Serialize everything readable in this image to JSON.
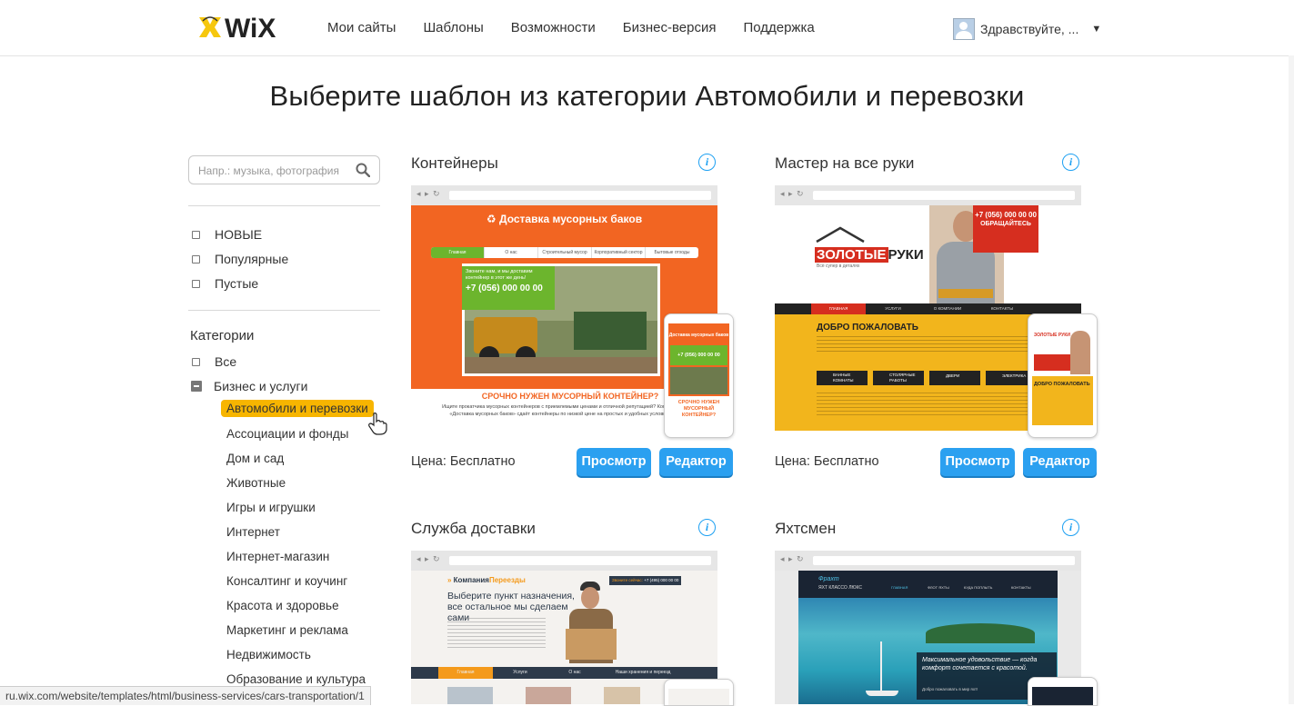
{
  "header": {
    "nav": [
      {
        "label": "Мои сайты"
      },
      {
        "label": "Шаблоны"
      },
      {
        "label": "Возможности"
      },
      {
        "label": "Бизнес-версия"
      },
      {
        "label": "Поддержка"
      }
    ],
    "user_greeting": "Здравствуйте, ...",
    "logo_text": "WiX"
  },
  "page_title": "Выберите шаблон из категории Автомобили и перевозки",
  "sidebar": {
    "search_placeholder": "Напр.: музыка, фотография",
    "filters": [
      {
        "label": "НОВЫЕ"
      },
      {
        "label": "Популярные"
      },
      {
        "label": "Пустые"
      }
    ],
    "categories_title": "Категории",
    "top_categories": [
      {
        "label": "Все"
      },
      {
        "label": "Бизнес и услуги"
      }
    ],
    "subcategories": [
      {
        "label": "Автомобили и перевозки",
        "active": true
      },
      {
        "label": "Ассоциации и фонды"
      },
      {
        "label": "Дом и сад"
      },
      {
        "label": "Животные"
      },
      {
        "label": "Игры и игрушки"
      },
      {
        "label": "Интернет"
      },
      {
        "label": "Интернет-магазин"
      },
      {
        "label": "Консалтинг и коучинг"
      },
      {
        "label": "Красота и здоровье"
      },
      {
        "label": "Маркетинг и реклама"
      },
      {
        "label": "Недвижимость"
      },
      {
        "label": "Образование и культура"
      }
    ]
  },
  "templates": [
    {
      "title": "Контейнеры",
      "price": "Цена: Бесплатно",
      "preview_label": "Просмотр",
      "edit_label": "Редактор",
      "thumb": {
        "heading": "Доставка мусорных баков",
        "menu": [
          "Главная",
          "О нас",
          "Строительный мусор",
          "Корпоративный сектор",
          "Бытовые отходы"
        ],
        "callout": "Звоните нам, и мы доставим контейнер в этот же день!",
        "phone": "+7 (056) 000 00 00",
        "banner": "СРОЧНО НУЖЕН МУСОРНЫЙ КОНТЕЙНЕР?",
        "body": "Ищите прокатчика мусорных контейнеров с приемлемыми ценами и отличной репутацией? Компания «Доставка мусорных баков» сдаёт контейнеры по низкой цене на простых и удобных условиях.",
        "mobile_heading": "Доставка мусорных баков",
        "mobile_phone": "+7 (056) 000 00 00",
        "mobile_banner": "СРОЧНО НУЖЕН МУСОРНЫЙ КОНТЕЙНЕР?",
        "colors": {
          "accent": "#f26522",
          "green": "#6cb52d"
        }
      }
    },
    {
      "title": "Мастер на все руки",
      "price": "Цена: Бесплатно",
      "preview_label": "Просмотр",
      "edit_label": "Редактор",
      "thumb": {
        "logo_a": "ЗОЛОТЫЕ",
        "logo_b": "РУКИ",
        "slogan": "Всё супер в деталях",
        "phone_badge": "+7 (056) 000 00 00",
        "phone_note": "ОБРАЩАЙТЕСЬ",
        "menu": [
          "ГЛАВНАЯ",
          "УСЛУГИ",
          "О КОМПАНИИ",
          "КОНТАКТЫ"
        ],
        "welcome": "ДОБРО ПОЖАЛОВАТЬ",
        "services": [
          "ВАННЫЕ КОМНАТЫ",
          "СТОЛЯРНЫЕ РАБОТЫ",
          "ДВЕРИ",
          "ЭЛЕКТРИКА"
        ],
        "mobile_logo": "ЗОЛОТЫЕ РУКИ",
        "mobile_welcome": "ДОБРО ПОЖАЛОВАТЬ",
        "colors": {
          "accent": "#f2b51c",
          "dark": "#222222",
          "red": "#d62e1f"
        }
      }
    },
    {
      "title": "Служба доставки",
      "price": "",
      "thumb": {
        "logo_a": "Компания",
        "logo_b": "Переезды",
        "phone_label": "Звоните сейчас:",
        "phone": "+7 (495) 000 00 00",
        "headline": "Выберите пункт назначения, все остальное мы сделаем сами",
        "menu": [
          "Главная",
          "Услуги",
          "О нас",
          "Наши хранения и переезд"
        ],
        "colors": {
          "accent": "#f49a1b",
          "dark": "#2d3a4a"
        }
      }
    },
    {
      "title": "Яхтсмен",
      "price": "",
      "thumb": {
        "logo": "Фрахт",
        "tagline": "ЯХТ КЛАССО ЛЮКС",
        "menu": [
          "ГЛАВНАЯ",
          "ФЛОТ ЯХТЫ",
          "КУДА ПОПЛЫТЬ",
          "КОНТАКТЫ"
        ],
        "caption": "Максимальное удовольствие — когда комфорт сочетается с красотой.",
        "caption2": "Добро пожаловать в мир яхт!",
        "colors": {
          "sea": "#2aa0b9",
          "dark": "#1a2433"
        }
      }
    }
  ],
  "status_url": "ru.wix.com/website/templates/html/business-services/cars-transportation/1"
}
